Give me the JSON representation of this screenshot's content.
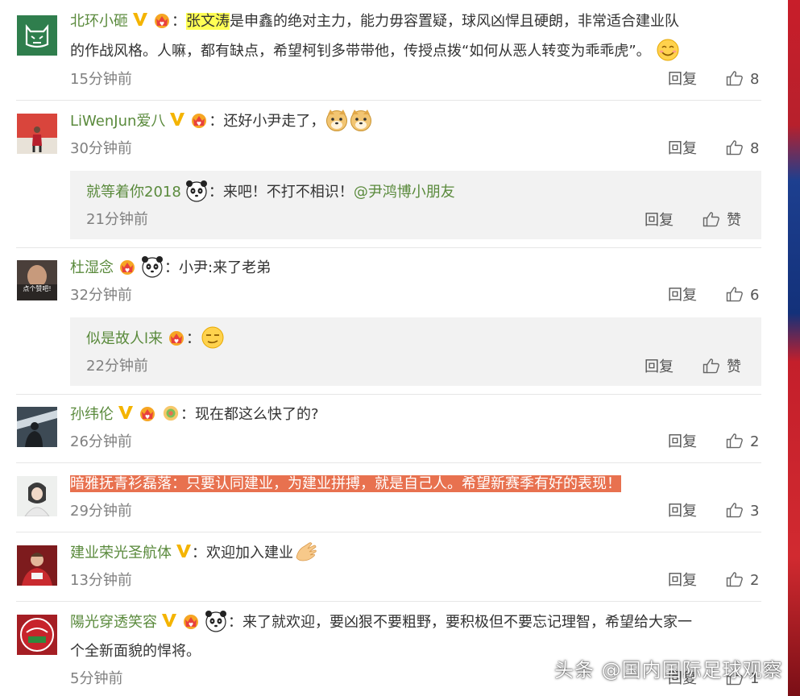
{
  "comments": [
    {
      "user": "北环小砸",
      "text_a": "张文涛",
      "text_b": "是申鑫的绝对主力，能力毋容置疑，球风凶悍且硬朗，非常适合建业队",
      "text_c": "的作战风格。人嘛，都有缺点，希望柯钊多带带他，传授点拨“如何从恶人转变为乖乖虎”。",
      "time": "15分钟前",
      "reply": "回复",
      "likes": "8"
    },
    {
      "user": "LiWenJun爱八",
      "text": "还好小尹走了，",
      "time": "30分钟前",
      "reply": "回复",
      "likes": "8",
      "sub": {
        "user": "就等着你2018",
        "text": "来吧！不打不相识！",
        "mention": "@尹鸿博小朋友",
        "time": "21分钟前",
        "reply": "回复",
        "likes": "赞"
      }
    },
    {
      "user": "杜湿念",
      "text": "小尹:来了老弟",
      "avatar_text": "点个赞吧!",
      "time": "32分钟前",
      "reply": "回复",
      "likes": "6",
      "sub": {
        "user": "似是故人l来",
        "time": "22分钟前",
        "reply": "回复",
        "likes": "赞"
      }
    },
    {
      "user": "孙纬伦",
      "text": "现在都这么快了的?",
      "time": "26分钟前",
      "reply": "回复",
      "likes": "2"
    },
    {
      "user": "暗雅抚青衫磊落",
      "text": "只要认同建业，为建业拼搏，就是自己人。希望新赛季有好的表现！",
      "time": "29分钟前",
      "reply": "回复",
      "likes": "3"
    },
    {
      "user": "建业荣光圣航体",
      "text": "欢迎加入建业",
      "time": "13分钟前",
      "reply": "回复",
      "likes": "2"
    },
    {
      "user": "陽光穿透笑容",
      "text_a": "来了就欢迎，要凶狠不要粗野，要积极但不要忘记理智，希望给大家一",
      "text_b": "个全新面貌的悍将。",
      "time": "5分钟前",
      "reply": "回复",
      "likes": "1"
    }
  ],
  "colon": "：",
  "watermark": "头条 @国内国际足球观察",
  "colors": {
    "username": "#5a8a3c",
    "highlight_yellow": "#ffff55",
    "highlight_orange": "#e8714f",
    "sub_bg": "#f2f2f2"
  }
}
